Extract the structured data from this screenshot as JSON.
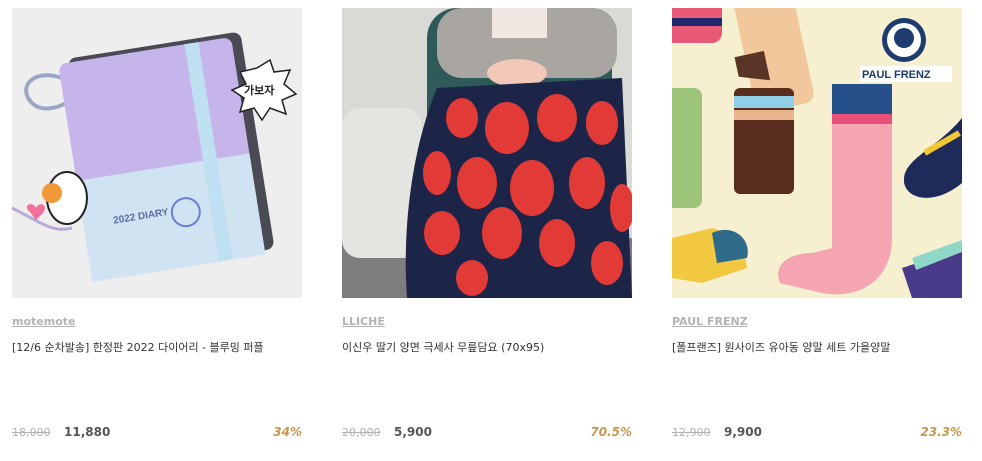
{
  "products": [
    {
      "brand": "motemote",
      "name": "[12/6 순차발송] 한정판 2022 다이어리 - 블루밍 퍼플",
      "original_price": "18,000",
      "sale_price": "11,880",
      "discount": "34%",
      "image_text": {
        "cover": "2022 DIARY",
        "sticker": "가보자"
      }
    },
    {
      "brand": "LLICHE",
      "name": "이신우 딸기 양면 극세사 무릎담요 (70x95)",
      "original_price": "20,000",
      "sale_price": "5,900",
      "discount": "70.5%"
    },
    {
      "brand": "PAUL FRENZ",
      "name": "[폴프랜즈] 원사이즈 유아동 양말 세트 가을양말",
      "original_price": "12,900",
      "sale_price": "9,900",
      "discount": "23.3%",
      "image_text": {
        "logo": "PAUL FRENZ"
      }
    }
  ],
  "colors": {
    "discount": "#c8964d",
    "muted": "#b3b3b3",
    "text": "#333333"
  }
}
